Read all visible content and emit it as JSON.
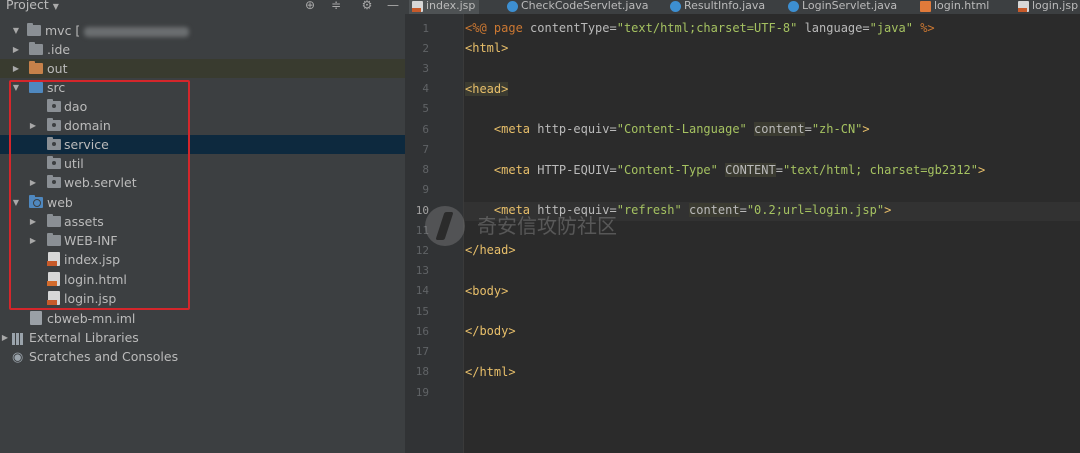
{
  "project_panel": {
    "title": "Project",
    "root_label": "mvc [",
    "tree": [
      {
        "label": ".ide",
        "icon": "folder-icon"
      },
      {
        "label": "out",
        "icon": "folder-orange-icon"
      },
      {
        "label": "src",
        "icon": "source-folder-icon"
      },
      {
        "label": "dao",
        "icon": "package-icon"
      },
      {
        "label": "domain",
        "icon": "package-icon"
      },
      {
        "label": "service",
        "icon": "package-icon"
      },
      {
        "label": "util",
        "icon": "package-icon"
      },
      {
        "label": "web.servlet",
        "icon": "package-icon"
      },
      {
        "label": "web",
        "icon": "web-folder-icon"
      },
      {
        "label": "assets",
        "icon": "folder-icon"
      },
      {
        "label": "WEB-INF",
        "icon": "folder-icon"
      },
      {
        "label": "index.jsp",
        "icon": "jsp-file-icon"
      },
      {
        "label": "login.html",
        "icon": "html-file-icon"
      },
      {
        "label": "login.jsp",
        "icon": "jsp-file-icon"
      },
      {
        "label": "cbweb-mn.iml",
        "icon": "iml-file-icon"
      },
      {
        "label": "External Libraries",
        "icon": "libraries-icon"
      },
      {
        "label": "Scratches and Consoles",
        "icon": "scratches-icon"
      }
    ],
    "highlight_color": "#d4262b"
  },
  "tabs": [
    {
      "label": "index.jsp",
      "icon": "jsp-file-icon",
      "active": true
    },
    {
      "label": "CheckCodeServlet.java",
      "icon": "java-class-icon"
    },
    {
      "label": "ResultInfo.java",
      "icon": "java-class-icon"
    },
    {
      "label": "LoginServlet.java",
      "icon": "java-class-icon"
    },
    {
      "label": "login.html",
      "icon": "html-file-icon"
    },
    {
      "label": "login.jsp",
      "icon": "jsp-file-icon"
    }
  ],
  "editor": {
    "current_line": 10,
    "line_numbers": [
      "1",
      "2",
      "3",
      "4",
      "5",
      "6",
      "7",
      "8",
      "9",
      "10",
      "11",
      "12",
      "13",
      "14",
      "15",
      "16",
      "17",
      "18",
      "19"
    ],
    "lines": {
      "l1_open": "<%@ ",
      "l1_page": "page",
      "l1_attr1": " contentType=",
      "l1_val1": "\"text/html;charset=UTF-8\"",
      "l1_attr2": " language=",
      "l1_val2": "\"java\"",
      "l1_close": " %>",
      "l2": "<html>",
      "l4": "<head>",
      "l6_tag": "<meta",
      "l6_attr1": " http-equiv=",
      "l6_val1": "\"Content-Language\"",
      "l6_attr2": "content",
      "l6_eq": "=",
      "l6_val2": "\"zh-CN\"",
      "l6_end": ">",
      "l8_tag": "<meta",
      "l8_attr1": " HTTP-EQUIV=",
      "l8_val1": "\"Content-Type\"",
      "l8_attr2": "CONTENT",
      "l8_eq": "=",
      "l8_val2": "\"text/html; charset=gb2312\"",
      "l8_end": ">",
      "l10_tag": "<meta",
      "l10_attr1": " http-equiv=",
      "l10_val1": "\"refresh\"",
      "l10_attr2": "content",
      "l10_eq": "=",
      "l10_val2": "\"0.2;url=login.jsp\"",
      "l10_end": ">",
      "l12": "</head>",
      "l14": "<body>",
      "l16": "</body>",
      "l18": "</html>"
    },
    "watermark": "奇安信攻防社区"
  }
}
